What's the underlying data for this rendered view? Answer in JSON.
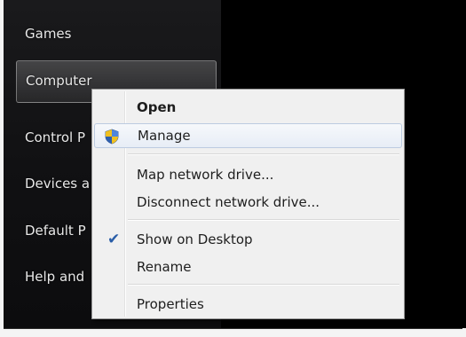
{
  "start_menu": {
    "items": [
      {
        "label": "Games"
      },
      {
        "label": "Computer"
      },
      {
        "label": "Control P"
      },
      {
        "label": "Devices a"
      },
      {
        "label": "Default P"
      },
      {
        "label": "Help and"
      }
    ]
  },
  "context_menu": {
    "items": [
      {
        "label": "Open",
        "icon": null
      },
      {
        "label": "Manage",
        "icon": "shield-icon"
      },
      {
        "label": "Map network drive..."
      },
      {
        "label": "Disconnect network drive..."
      },
      {
        "label": "Show on Desktop",
        "icon": "checkmark-icon"
      },
      {
        "label": "Rename"
      },
      {
        "label": "Properties"
      }
    ]
  },
  "colors": {
    "menu_hover_border": "#bccbe0",
    "check_color": "#2a5ea8"
  }
}
